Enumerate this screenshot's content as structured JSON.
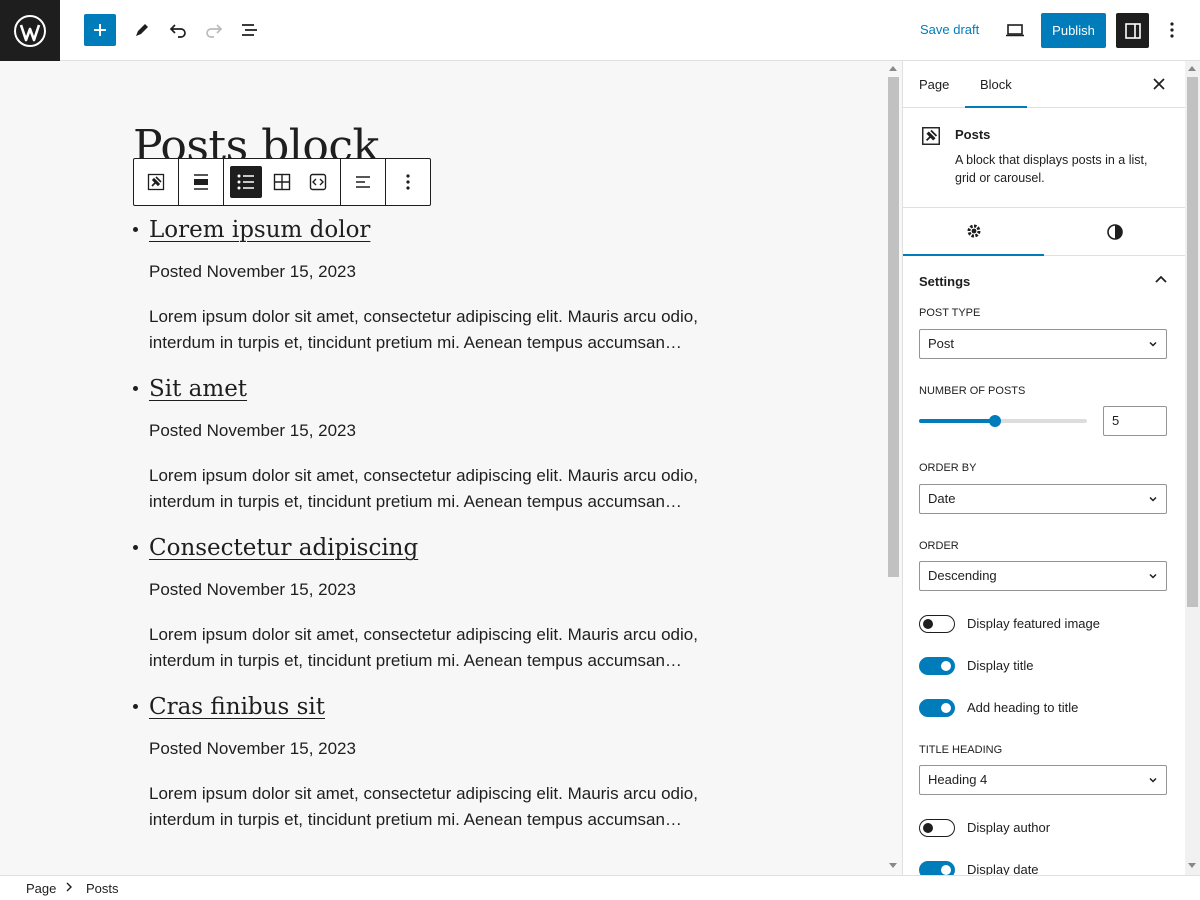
{
  "header": {
    "save_draft": "Save draft",
    "publish": "Publish"
  },
  "editor": {
    "page_title": "Posts block",
    "posts": [
      {
        "title": "Lorem ipsum dolor",
        "date": "Posted November 15, 2023",
        "excerpt": "Lorem ipsum dolor sit amet, consectetur adipiscing elit. Mauris arcu odio, interdum in turpis et, tincidunt pretium mi. Aenean tempus accumsan…"
      },
      {
        "title": "Sit amet",
        "date": "Posted November 15, 2023",
        "excerpt": "Lorem ipsum dolor sit amet, consectetur adipiscing elit. Mauris arcu odio, interdum in turpis et, tincidunt pretium mi. Aenean tempus accumsan…"
      },
      {
        "title": "Consectetur adipiscing",
        "date": "Posted November 15, 2023",
        "excerpt": "Lorem ipsum dolor sit amet, consectetur adipiscing elit. Mauris arcu odio, interdum in turpis et, tincidunt pretium mi. Aenean tempus accumsan…"
      },
      {
        "title": "Cras finibus sit",
        "date": "Posted November 15, 2023",
        "excerpt": "Lorem ipsum dolor sit amet, consectetur adipiscing elit. Mauris arcu odio, interdum in turpis et, tincidunt pretium mi. Aenean tempus accumsan…"
      }
    ]
  },
  "sidebar": {
    "tabs": {
      "page": "Page",
      "block": "Block"
    },
    "block_card": {
      "name": "Posts",
      "description": "A block that displays posts in a list, grid or carousel."
    },
    "settings_title": "Settings",
    "post_type": {
      "label": "POST TYPE",
      "value": "Post"
    },
    "number_of_posts": {
      "label": "NUMBER OF POSTS",
      "value": "5",
      "slider_fraction": 0.45
    },
    "order_by": {
      "label": "ORDER BY",
      "value": "Date"
    },
    "order": {
      "label": "ORDER",
      "value": "Descending"
    },
    "toggles": {
      "featured_image": {
        "label": "Display featured image",
        "on": false
      },
      "title": {
        "label": "Display title",
        "on": true
      },
      "heading": {
        "label": "Add heading to title",
        "on": true
      },
      "author": {
        "label": "Display author",
        "on": false
      },
      "date": {
        "label": "Display date",
        "on": true
      }
    },
    "title_heading": {
      "label": "TITLE HEADING",
      "value": "Heading 4"
    }
  },
  "footer": {
    "breadcrumb": [
      "Page",
      "Posts"
    ]
  },
  "colors": {
    "accent": "#007cba",
    "dark": "#1e1e1e"
  }
}
